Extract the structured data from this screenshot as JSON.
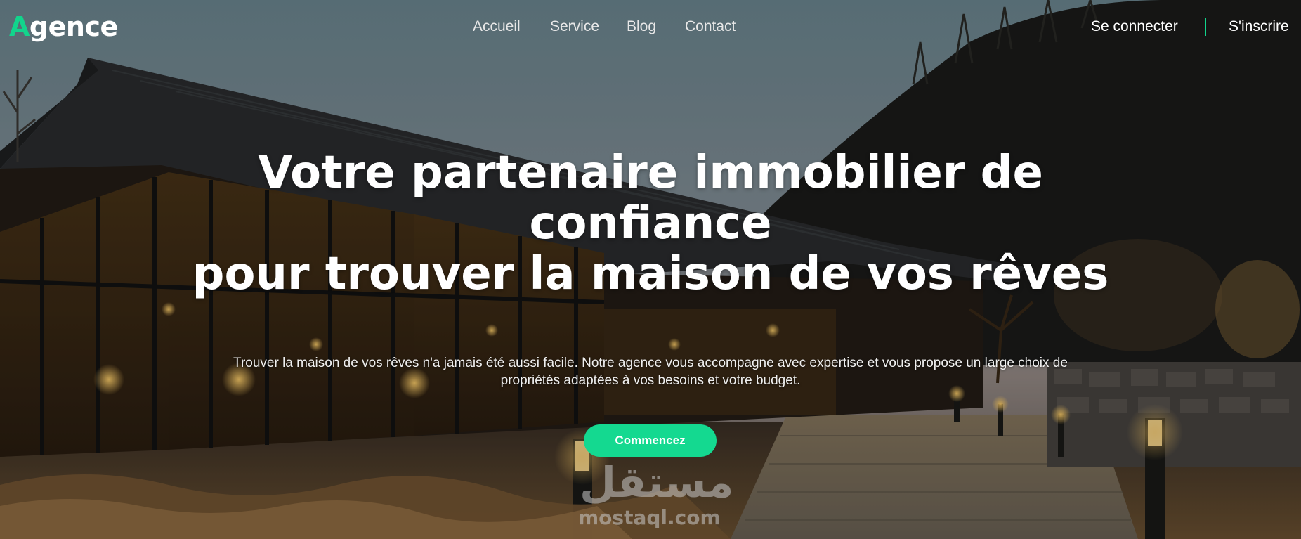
{
  "brand": {
    "logo_first_letter": "A",
    "logo_rest": "gence",
    "accent_color": "#12d48c"
  },
  "nav": {
    "items": [
      {
        "label": "Accueil"
      },
      {
        "label": "Service"
      },
      {
        "label": "Blog"
      },
      {
        "label": "Contact"
      }
    ]
  },
  "auth": {
    "login_label": "Se connecter",
    "signup_label": "S'inscrire"
  },
  "hero": {
    "title_line1": "Votre partenaire immobilier de",
    "title_line2": "confiance",
    "title_line3": "pour trouver la maison de vos rêves",
    "description": "Trouver la maison de vos rêves n'a jamais été aussi facile. Notre agence vous accompagne avec expertise et vous propose un large choix de propriétés adaptées à vos besoins et votre budget.",
    "cta_label": "Commencez",
    "cta_color": "#14d990"
  },
  "watermark": {
    "arabic": "مستقل",
    "latin": "mostaql.com"
  }
}
